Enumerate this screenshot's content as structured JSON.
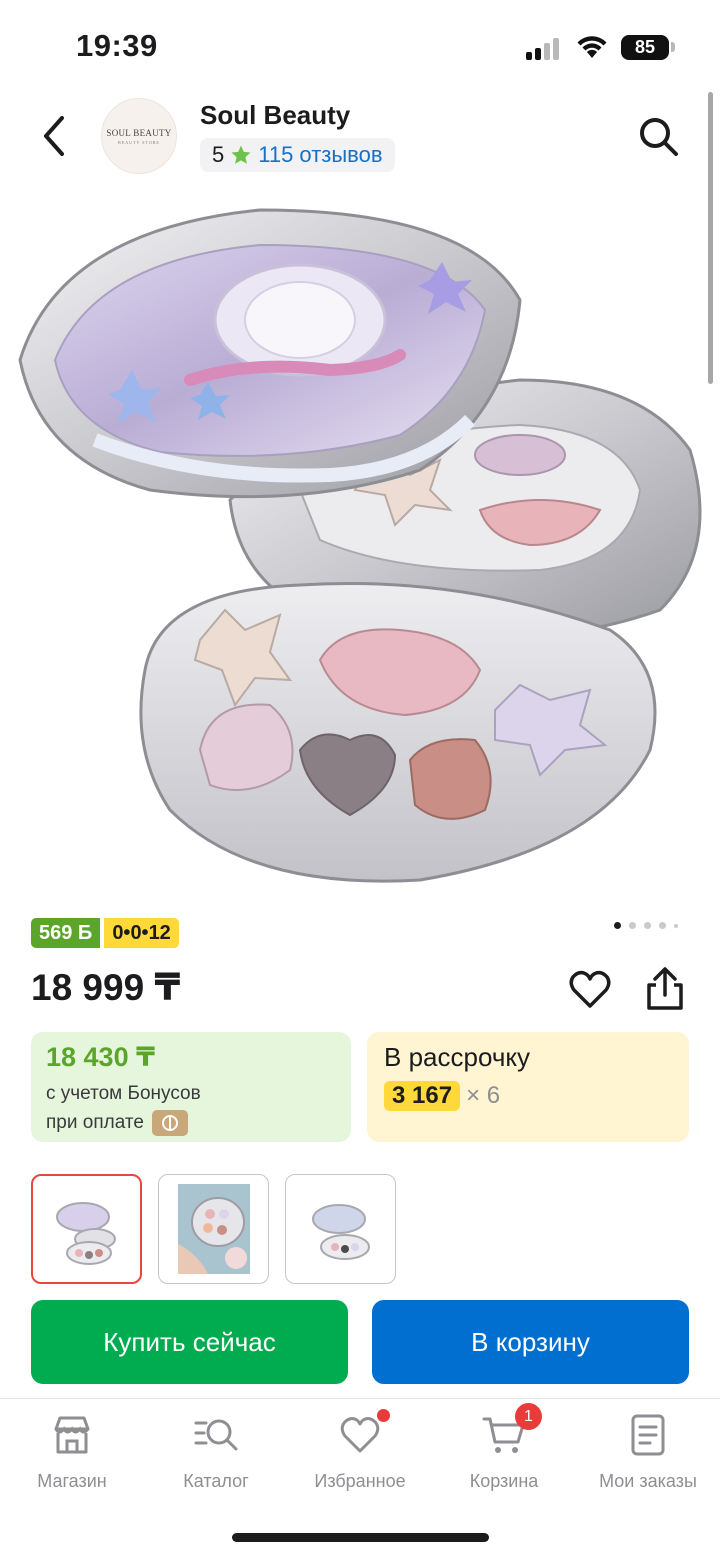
{
  "status_bar": {
    "time": "19:39",
    "battery": "85",
    "icons": [
      "signal-icon",
      "wifi-icon",
      "battery-icon"
    ]
  },
  "header": {
    "shop_name": "Soul Beauty",
    "logo_text": "SOUL BEAUTY",
    "logo_subtext": "BEAUTY STORE",
    "rating": "5",
    "reviews": "115 отзывов",
    "icons": [
      "chevron-left-icon",
      "star-icon",
      "search-icon"
    ]
  },
  "product": {
    "image_description": "shell-shaped eyeshadow palette with starfish and seashell pans",
    "bonus_badge": "569 Б",
    "installment_badge": "0•0•12",
    "carousel": {
      "total": 5,
      "active_index": 0
    },
    "price": "18 999 ₸",
    "bonus_offer": {
      "price": "18 430 ₸",
      "line1": "с учетом Бонусов",
      "line2": "при оплате"
    },
    "installment_offer": {
      "title": "В рассрочку",
      "amount": "3 167",
      "months": "× 6"
    },
    "thumbnails": [
      {
        "name": "palette-open",
        "active": true
      },
      {
        "name": "palette-in-hand",
        "active": false
      },
      {
        "name": "palette-angled",
        "active": false
      }
    ]
  },
  "actions": {
    "buy_now": "Купить сейчас",
    "add_to_cart": "В корзину"
  },
  "tab_bar": {
    "tabs": [
      {
        "id": "shop",
        "label": "Магазин",
        "icon": "store-icon"
      },
      {
        "id": "catalog",
        "label": "Каталог",
        "icon": "catalog-search-icon"
      },
      {
        "id": "favorites",
        "label": "Избранное",
        "icon": "heart-icon"
      },
      {
        "id": "cart",
        "label": "Корзина",
        "icon": "cart-icon",
        "badge": "1"
      },
      {
        "id": "orders",
        "label": "Мои заказы",
        "icon": "orders-icon"
      }
    ]
  },
  "colors": {
    "accent_green": "#00ac4f",
    "accent_blue": "#006fcf",
    "bonus_green": "#5ba52a",
    "installment_yellow": "#ffd83a",
    "badge_red": "#ea3b3b",
    "link_blue": "#1770c4"
  }
}
